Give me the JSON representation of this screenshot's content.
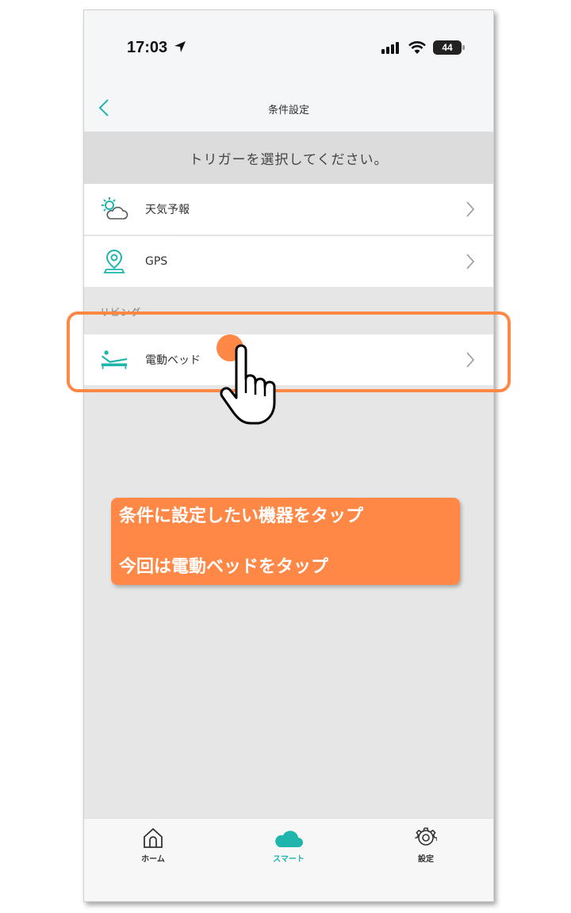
{
  "status_bar": {
    "time": "17:03",
    "battery": "44"
  },
  "nav": {
    "title": "条件設定"
  },
  "prompt": "トリガーを選択してください。",
  "triggers": [
    {
      "label": "天気予報",
      "icon": "weather-icon"
    },
    {
      "label": "GPS",
      "icon": "location-pin-icon"
    }
  ],
  "section": {
    "title": "リビング"
  },
  "devices": [
    {
      "label": "電動ベッド",
      "icon": "electric-bed-icon"
    }
  ],
  "callout": {
    "line1": "条件に設定したい機器をタップ",
    "line2": "今回は電動ベッドをタップ"
  },
  "tabs": [
    {
      "label": "ホーム",
      "icon": "home-icon",
      "active": false
    },
    {
      "label": "スマート",
      "icon": "cloud-icon",
      "active": true
    },
    {
      "label": "設定",
      "icon": "gear-icon",
      "active": false
    }
  ],
  "colors": {
    "accent": "#1fb5ad",
    "annotation": "#ff8847"
  }
}
